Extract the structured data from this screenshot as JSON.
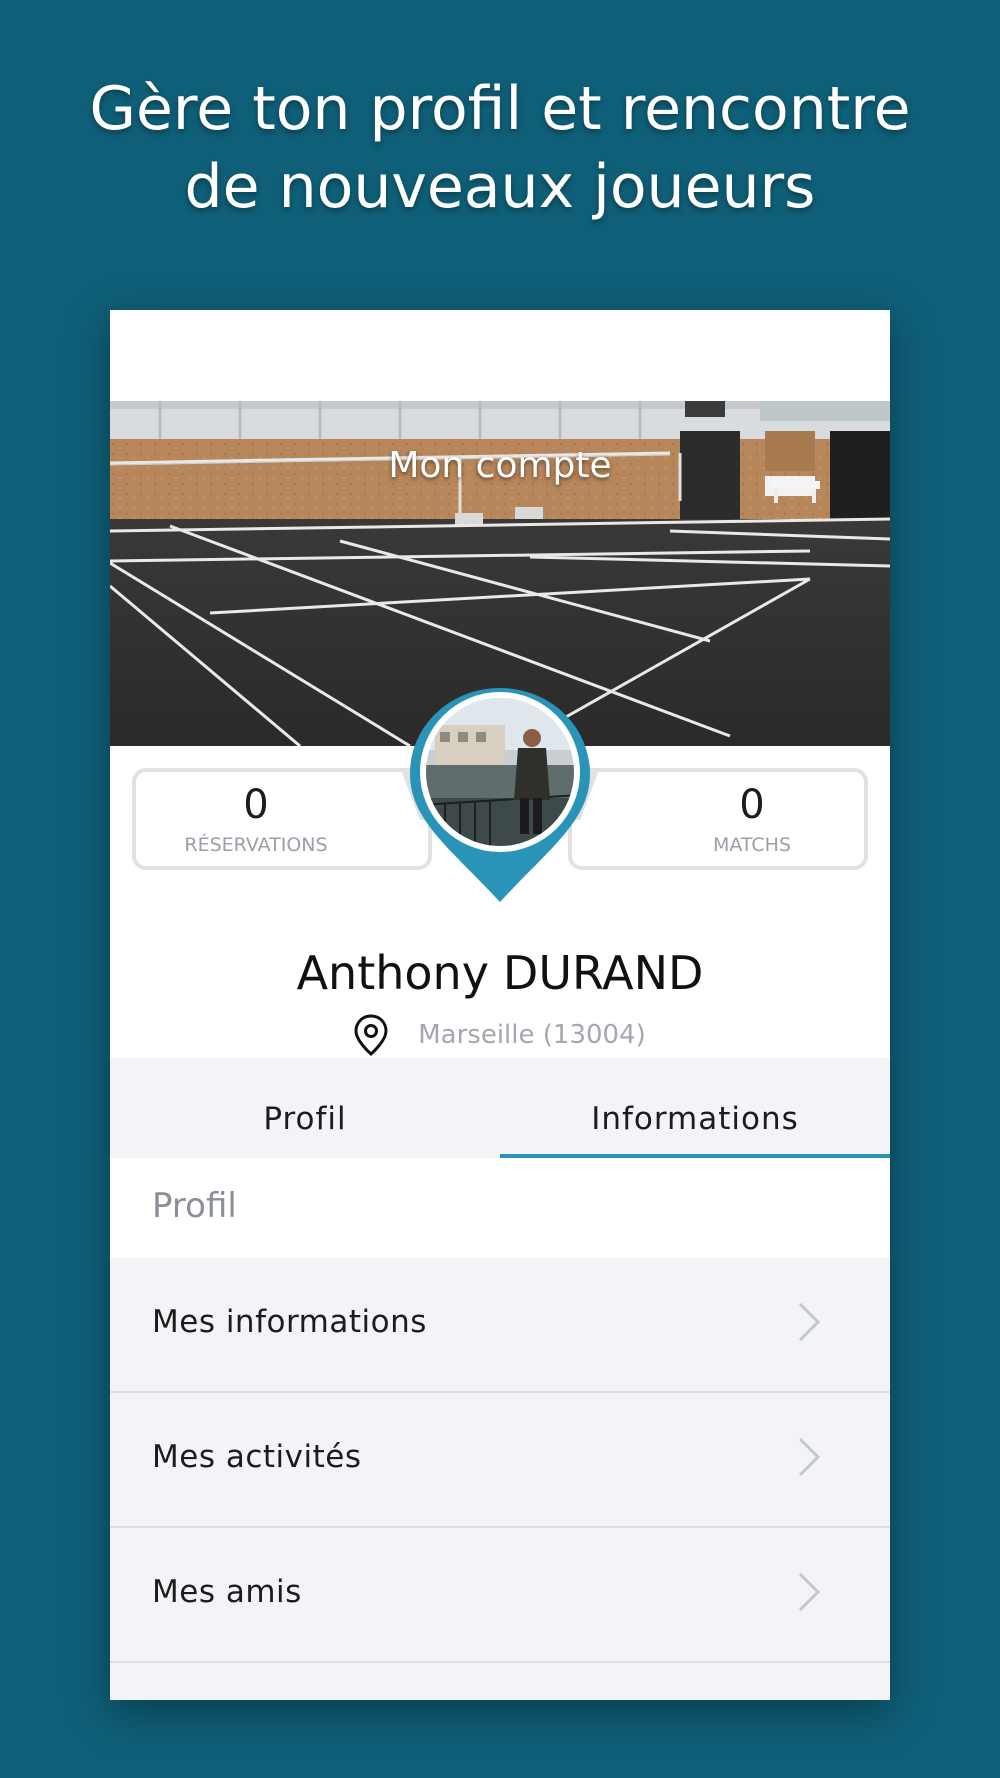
{
  "headline": {
    "line1": "Gère ton profil et rencontre",
    "line2": "de nouveaux joueurs"
  },
  "colors": {
    "background": "#0f5f78",
    "accent": "#2a93b8",
    "muted_text": "#a3a7ae"
  },
  "hero": {
    "title": "Mon compte",
    "image": "badminton-court-photo"
  },
  "stats": {
    "left": {
      "value": "0",
      "label": "RÉSERVATIONS"
    },
    "right": {
      "value": "0",
      "label": "MATCHS"
    }
  },
  "avatar": {
    "image": "profile-photo"
  },
  "user": {
    "first_name": "Anthony",
    "last_name": "DURAND",
    "location": "Marseille (13004)",
    "location_icon": "map-pin-icon"
  },
  "tabs": [
    {
      "label": "Profil",
      "active": false
    },
    {
      "label": "Informations",
      "active": true
    }
  ],
  "section": {
    "title": "Profil"
  },
  "menu": [
    {
      "label": "Mes informations",
      "icon": "chevron-right-icon"
    },
    {
      "label": "Mes activités",
      "icon": "chevron-right-icon"
    },
    {
      "label": "Mes amis",
      "icon": "chevron-right-icon"
    }
  ]
}
